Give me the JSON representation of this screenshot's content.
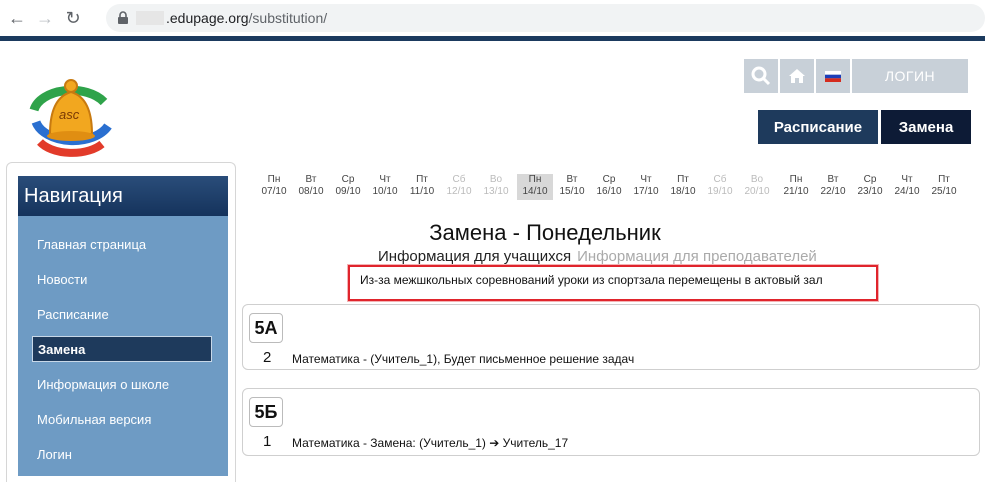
{
  "browser": {
    "url_host": ".edupage.org",
    "url_path": "/substitution/"
  },
  "header": {
    "login_label": "ЛОГИН",
    "tabs": [
      {
        "label": "Расписание"
      },
      {
        "label": "Замена"
      }
    ]
  },
  "sidebar": {
    "title": "Навигация",
    "items": [
      {
        "label": "Главная страница"
      },
      {
        "label": "Новости"
      },
      {
        "label": "Расписание"
      },
      {
        "label": "Замена"
      },
      {
        "label": "Информация о школе"
      },
      {
        "label": "Мобильная версия"
      },
      {
        "label": "Логин"
      }
    ]
  },
  "days": [
    {
      "dow": "Пн",
      "date": "07/10"
    },
    {
      "dow": "Вт",
      "date": "08/10"
    },
    {
      "dow": "Ср",
      "date": "09/10"
    },
    {
      "dow": "Чт",
      "date": "10/10"
    },
    {
      "dow": "Пт",
      "date": "11/10"
    },
    {
      "dow": "Сб",
      "date": "12/10"
    },
    {
      "dow": "Во",
      "date": "13/10"
    },
    {
      "dow": "Пн",
      "date": "14/10"
    },
    {
      "dow": "Вт",
      "date": "15/10"
    },
    {
      "dow": "Ср",
      "date": "16/10"
    },
    {
      "dow": "Чт",
      "date": "17/10"
    },
    {
      "dow": "Пт",
      "date": "18/10"
    },
    {
      "dow": "Сб",
      "date": "19/10"
    },
    {
      "dow": "Во",
      "date": "20/10"
    },
    {
      "dow": "Пн",
      "date": "21/10"
    },
    {
      "dow": "Вт",
      "date": "22/10"
    },
    {
      "dow": "Ср",
      "date": "23/10"
    },
    {
      "dow": "Чт",
      "date": "24/10"
    },
    {
      "dow": "Пт",
      "date": "25/10"
    }
  ],
  "main": {
    "title": "Замена - Понедельник",
    "info_tabs": [
      {
        "label": "Информация для учащихся"
      },
      {
        "label": "Информация для преподавателей"
      }
    ],
    "notice": "Из-за межшкольных соревнований уроки  из спортзала перемещены в актовый зал",
    "classes": [
      {
        "name": "5А",
        "lesson": "2",
        "text": "Математика - (Учитель_1), Будет письменное решение задач"
      },
      {
        "name": "5Б",
        "lesson": "1",
        "text": "Математика - Замена: (Учитель_1) ➔ Учитель_17"
      }
    ]
  }
}
